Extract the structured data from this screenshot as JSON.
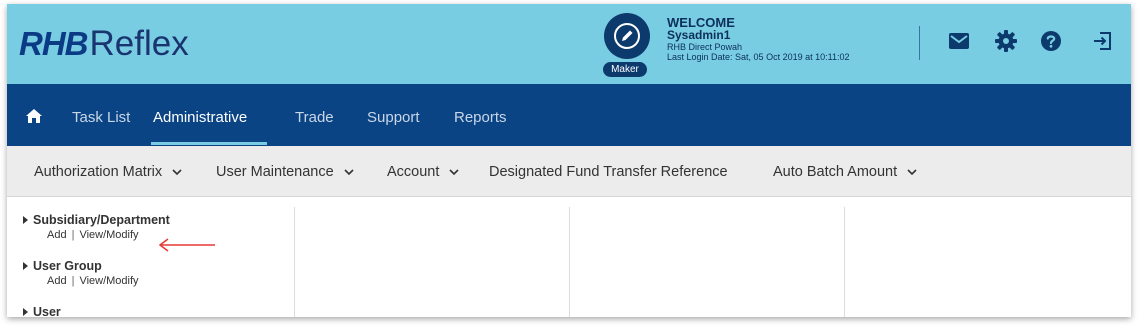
{
  "brand": {
    "logo_prefix": "RHB",
    "logo_suffix": "Reflex"
  },
  "user": {
    "role_badge": "Maker",
    "welcome": "WELCOME",
    "username": "Sysadmin1",
    "company": "RHB Direct Powah",
    "last_login": "Last Login Date: Sat, 05 Oct 2019 at 10:11:02"
  },
  "header_icons": [
    "mail-icon",
    "gear-icon",
    "help-icon",
    "logout-icon"
  ],
  "nav": {
    "items": [
      {
        "label": "Task List"
      },
      {
        "label": "Administrative"
      },
      {
        "label": "Trade"
      },
      {
        "label": "Support"
      },
      {
        "label": "Reports"
      }
    ],
    "active": "Administrative"
  },
  "submenu": {
    "items": [
      {
        "label": "Authorization Matrix"
      },
      {
        "label": "User Maintenance"
      },
      {
        "label": "Account"
      },
      {
        "label": "Designated Fund Transfer Reference"
      },
      {
        "label": "Auto Batch Amount"
      }
    ]
  },
  "sections": [
    {
      "title": "Subsidiary/Department",
      "links": [
        "Add",
        "View/Modify"
      ]
    },
    {
      "title": "User Group",
      "links": [
        "Add",
        "View/Modify"
      ]
    },
    {
      "title": "User",
      "links": []
    }
  ],
  "link_separator": "|",
  "colors": {
    "header_bg": "#78cde3",
    "nav_bg": "#0a4484",
    "submenu_bg": "#ececec",
    "annotation_arrow": "#e53935"
  }
}
